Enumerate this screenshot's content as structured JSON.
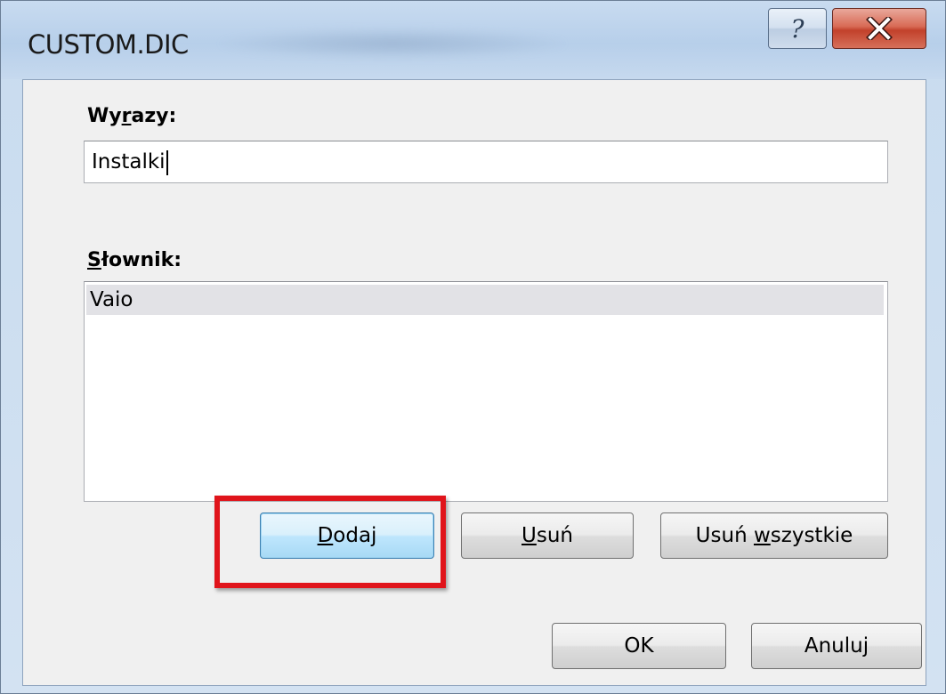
{
  "window": {
    "title": "CUSTOM.DIC",
    "help_label": "?",
    "close_label": "x"
  },
  "words": {
    "label_prefix": "Wy",
    "label_accel": "r",
    "label_suffix": "azy:",
    "value": "Instalki"
  },
  "dictionary": {
    "label_accel": "S",
    "label_suffix": "łownik:",
    "items": [
      "Vaio"
    ]
  },
  "buttons": {
    "add": {
      "accel": "D",
      "rest": "odaj"
    },
    "remove": {
      "accel": "U",
      "rest": "suń"
    },
    "remove_all": {
      "prefix": "Usuń ",
      "accel": "w",
      "rest": "szystkie"
    },
    "ok": "OK",
    "cancel": "Anuluj"
  },
  "colors": {
    "highlight": "#e0141b",
    "selection": "#e2e2e6",
    "close_button": "#c2412b"
  }
}
